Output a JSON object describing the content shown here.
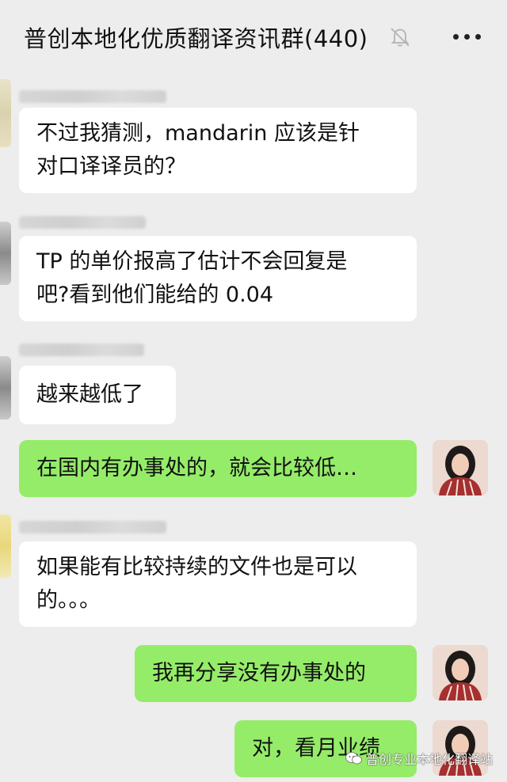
{
  "header": {
    "title": "普创本地化优质翻译资讯群(440)",
    "mute_icon": "bell-muted-icon",
    "more_icon": "more-dots-icon"
  },
  "messages": [
    {
      "side": "in",
      "text": "不过我猜测，mandarin 应该是针\n对口译译员的？"
    },
    {
      "side": "in",
      "text": "TP 的单价报高了估计不会回复是\n吧?看到他们能给的 0.04"
    },
    {
      "side": "in",
      "text": "越来越低了"
    },
    {
      "side": "out",
      "text": "在国内有办事处的，就会比较低…"
    },
    {
      "side": "in",
      "text": "如果能有比较持续的文件也是可以\n的。。。"
    },
    {
      "side": "out",
      "text": "我再分享没有办事处的"
    },
    {
      "side": "out",
      "text": "对，看月业绩"
    }
  ],
  "watermark": "普创专业本地化翻译站",
  "colors": {
    "background": "#ededed",
    "incoming_bubble": "#ffffff",
    "outgoing_bubble": "#95ec69"
  }
}
